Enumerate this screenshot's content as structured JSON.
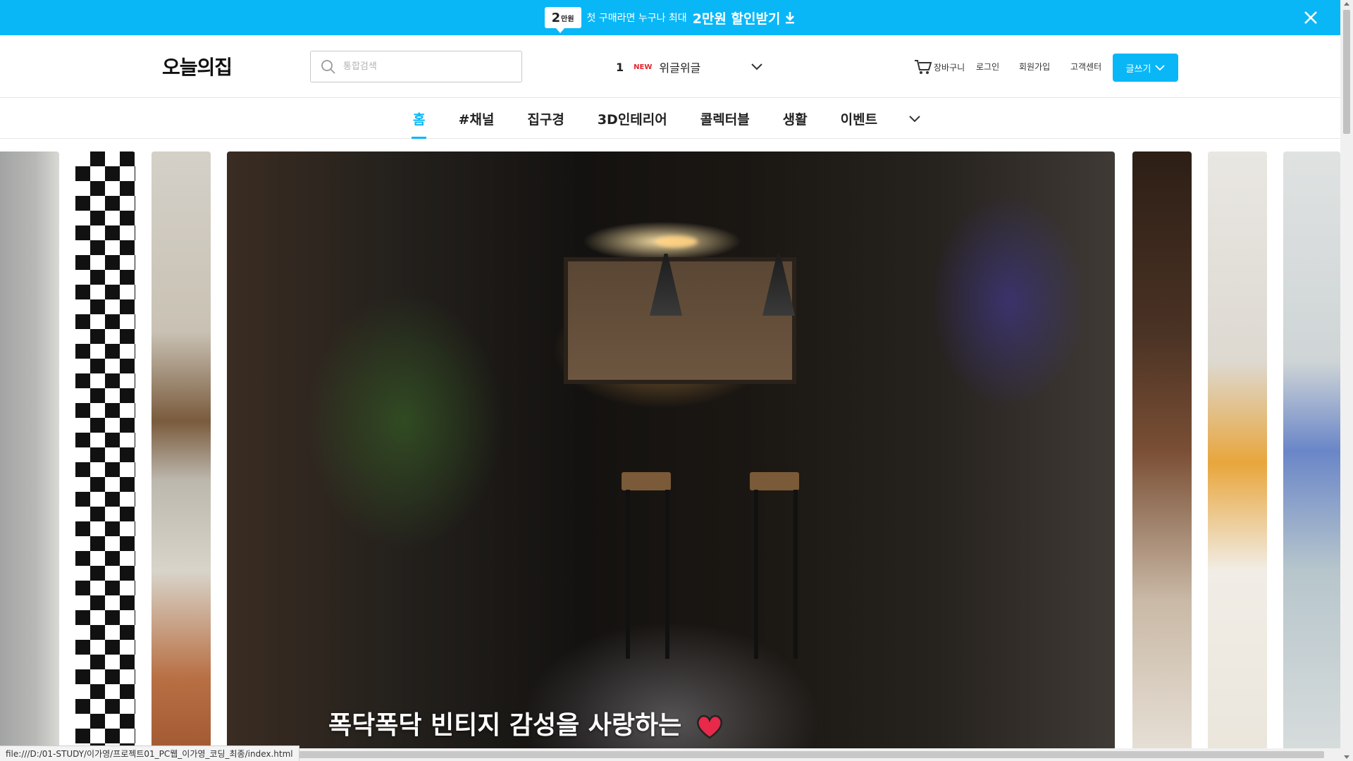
{
  "promo": {
    "badge_big": "2",
    "badge_small": "만원",
    "text": "첫 구매라면 누구나 최대",
    "highlight": "2만원 할인받기"
  },
  "header": {
    "logo": "오늘의집",
    "search_placeholder": "통합검색",
    "trending": {
      "rank": "1",
      "badge": "NEW",
      "word": "위글위글"
    },
    "cart_label": "장바구니",
    "login_label": "로그인",
    "signup_label": "회원가입",
    "support_label": "고객센터",
    "write_label": "글쓰기"
  },
  "categories": [
    {
      "label": "홈",
      "active": true
    },
    {
      "label": "#채널"
    },
    {
      "label": "집구경"
    },
    {
      "label": "3D인테리어"
    },
    {
      "label": "콜렉터블"
    },
    {
      "label": "생활"
    },
    {
      "label": "이벤트"
    }
  ],
  "slider": {
    "caption": "폭닥폭닥 빈티지 감성을 사랑하는"
  },
  "status": {
    "url": "file:///D:/01-STUDY/이가영/프로젝트01_PC웹_이가영_코딩_최종/index.html"
  },
  "colors": {
    "accent": "#09b7f7",
    "new_badge": "#e5252a"
  }
}
